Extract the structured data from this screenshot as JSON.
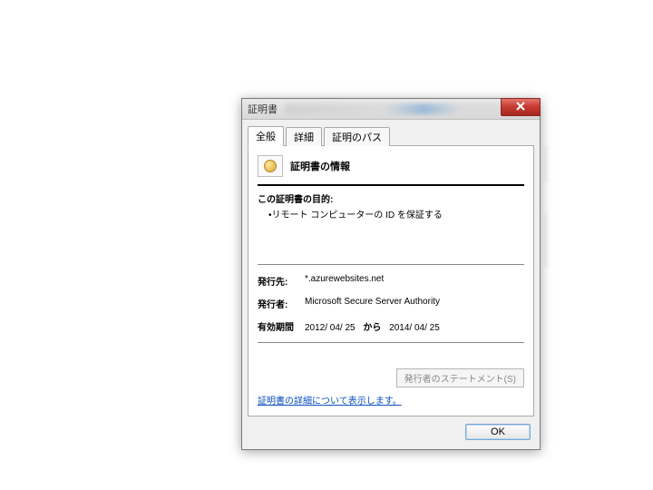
{
  "window": {
    "title": "証明書"
  },
  "tabs": {
    "general": "全般",
    "details": "詳細",
    "path": "証明のパス"
  },
  "header": {
    "title": "証明書の情報"
  },
  "purpose": {
    "label": "この証明書の目的:",
    "items": [
      "•リモート コンピューターの ID を保証する"
    ]
  },
  "fields": {
    "issued_to_label": "発行先:",
    "issued_to_value": "*.azurewebsites.net",
    "issuer_label": "発行者:",
    "issuer_value": "Microsoft Secure Server Authority",
    "validity_label": "有効期間",
    "valid_from": "2012/ 04/ 25",
    "valid_sep": "から",
    "valid_to": "2014/ 04/ 25"
  },
  "issuer_statement_button": "発行者のステートメント(S)",
  "details_link": "証明書の詳細について表示します。",
  "ok_button": "OK"
}
